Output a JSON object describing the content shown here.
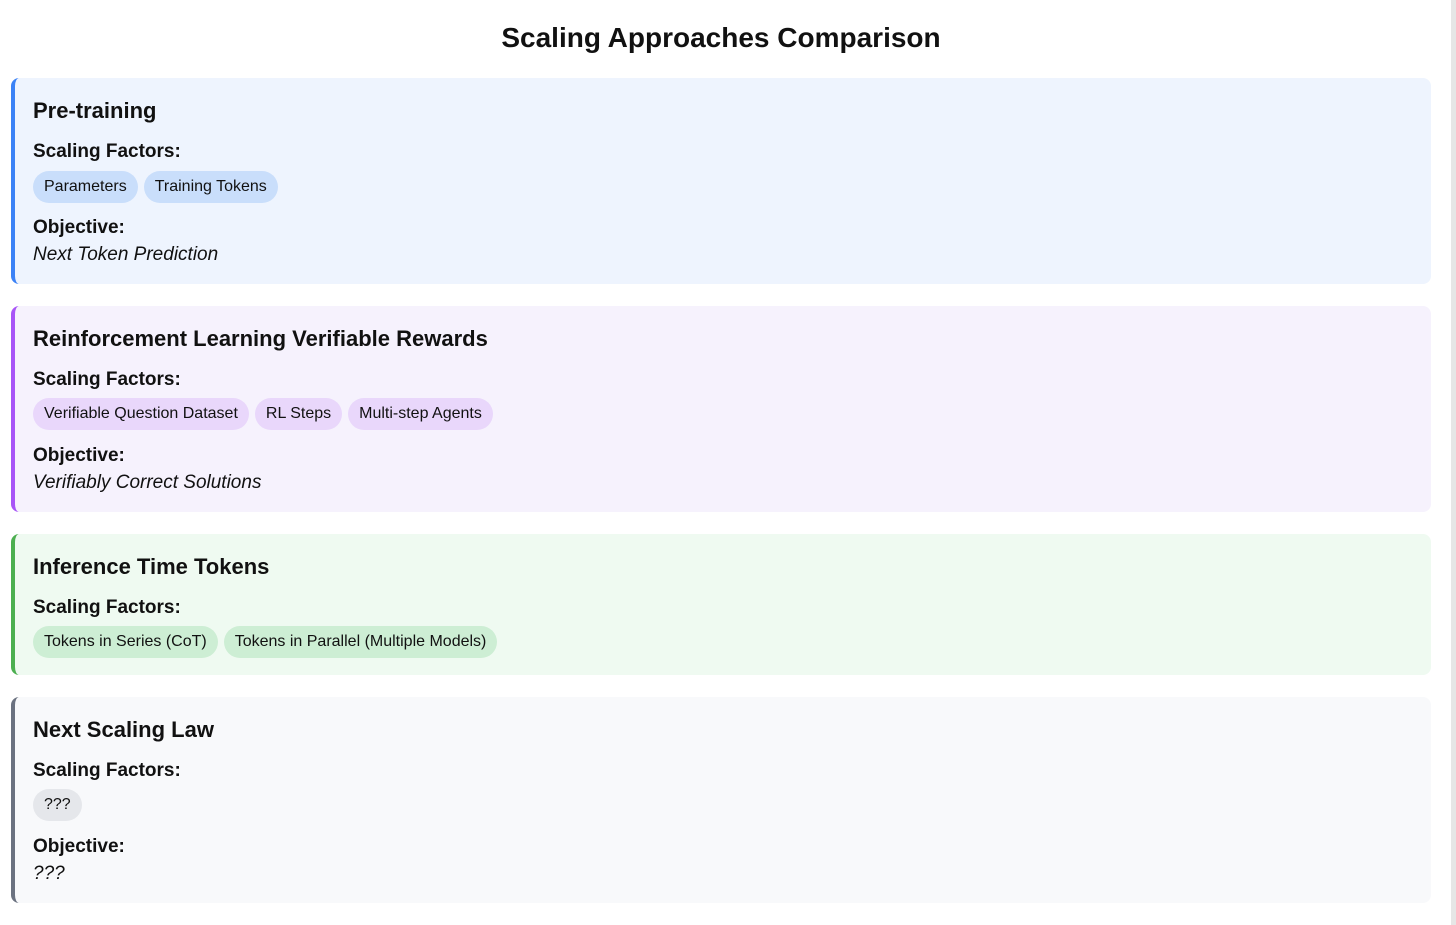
{
  "page_title": "Scaling Approaches Comparison",
  "cards": [
    {
      "title": "Pre-training",
      "scaling_label": "Scaling Factors:",
      "factors": [
        "Parameters",
        "Training Tokens"
      ],
      "objective_label": "Objective:",
      "objective": "Next Token Prediction",
      "accent": "#3b82f6"
    },
    {
      "title": "Reinforcement Learning Verifiable Rewards",
      "scaling_label": "Scaling Factors:",
      "factors": [
        "Verifiable Question Dataset",
        "RL Steps",
        "Multi-step Agents"
      ],
      "objective_label": "Objective:",
      "objective": "Verifiably Correct Solutions",
      "accent": "#a855f7"
    },
    {
      "title": "Inference Time Tokens",
      "scaling_label": "Scaling Factors:",
      "factors": [
        "Tokens in Series (CoT)",
        "Tokens in Parallel (Multiple Models)"
      ],
      "accent": "#4caf50"
    },
    {
      "title": "Next Scaling Law",
      "scaling_label": "Scaling Factors:",
      "factors": [
        "???"
      ],
      "objective_label": "Objective:",
      "objective": "???",
      "accent": "#6b7280"
    }
  ]
}
